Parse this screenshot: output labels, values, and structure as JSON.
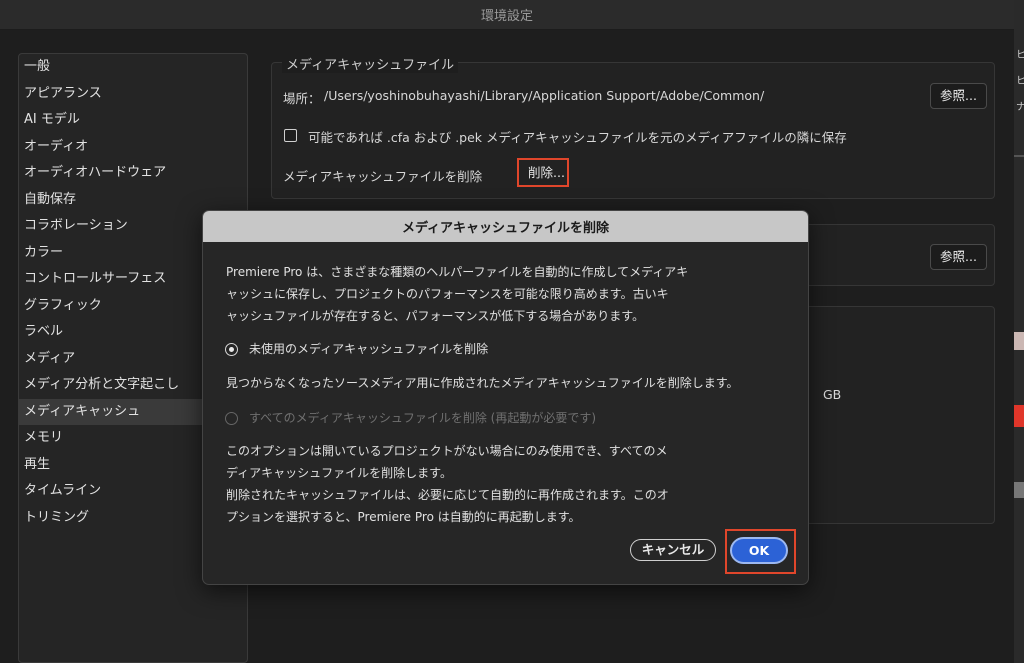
{
  "window": {
    "title": "環境設定"
  },
  "sidebar": {
    "items": [
      {
        "label": "一般",
        "selected": false
      },
      {
        "label": "アピアランス",
        "selected": false
      },
      {
        "label": "AI モデル",
        "selected": false
      },
      {
        "label": "オーディオ",
        "selected": false
      },
      {
        "label": "オーディオハードウェア",
        "selected": false
      },
      {
        "label": "自動保存",
        "selected": false
      },
      {
        "label": "コラボレーション",
        "selected": false
      },
      {
        "label": "カラー",
        "selected": false
      },
      {
        "label": "コントロールサーフェス",
        "selected": false
      },
      {
        "label": "グラフィック",
        "selected": false
      },
      {
        "label": "ラベル",
        "selected": false
      },
      {
        "label": "メディア",
        "selected": false
      },
      {
        "label": "メディア分析と文字起こし",
        "selected": false
      },
      {
        "label": "メディアキャッシュ",
        "selected": true
      },
      {
        "label": "メモリ",
        "selected": false
      },
      {
        "label": "再生",
        "selected": false
      },
      {
        "label": "タイムライン",
        "selected": false
      },
      {
        "label": "トリミング",
        "selected": false
      }
    ]
  },
  "cache_files": {
    "title": "メディアキャッシュファイル",
    "location_label": "場所：",
    "location_path": "/Users/yoshinobuhayashi/Library/Application Support/Adobe/Common/",
    "browse_label": "参照...",
    "save_next_checkbox_label": "可能であれば .cfa および .pek メディアキャッシュファイルを元のメディアファイルの隣に保存",
    "save_next_checked": false,
    "delete_label": "メディアキャッシュファイルを削除",
    "delete_button_label": "削除..."
  },
  "second_group": {
    "browse_label": "参照..."
  },
  "third_group": {
    "unit": "GB"
  },
  "dialog": {
    "title": "メディアキャッシュファイルを削除",
    "intro_lines": [
      "Premiere Pro は、さまざまな種類のヘルパーファイルを自動的に作成してメディアキ",
      "ャッシュに保存し、プロジェクトのパフォーマンスを可能な限り高めます。古いキ",
      "ャッシュファイルが存在すると、パフォーマンスが低下する場合があります。"
    ],
    "option_unused": {
      "label": "未使用のメディアキャッシュファイルを削除",
      "selected": true
    },
    "unused_desc": "見つからなくなったソースメディア用に作成されたメディアキャッシュファイルを削除します。",
    "option_all": {
      "label": "すべてのメディアキャッシュファイルを削除 (再起動が必要です)",
      "selected": false,
      "enabled": false
    },
    "all_desc_lines": [
      "このオプションは開いているプロジェクトがない場合にのみ使用でき、すべてのメ",
      "ディアキャッシュファイルを削除します。",
      "削除されたキャッシュファイルは、必要に応じて自動的に再作成されます。このオ",
      "プションを選択すると、Premiere Pro は自動的に再起動します。"
    ],
    "cancel_label": "キャンセル",
    "ok_label": "OK"
  },
  "colors": {
    "highlight": "#e0462b",
    "primary_button": "#2c62d6",
    "dialog_header": "#c7c7c7"
  }
}
